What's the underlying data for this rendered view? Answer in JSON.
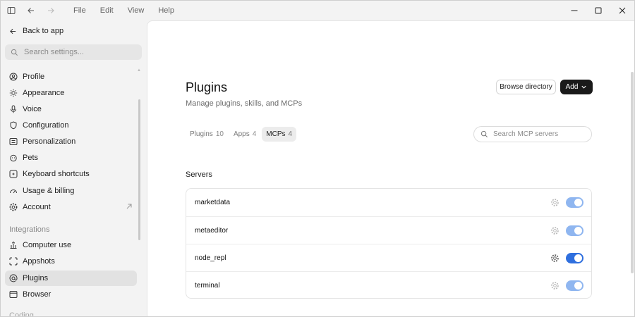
{
  "titlebar": {
    "menu": [
      "File",
      "Edit",
      "View",
      "Help"
    ]
  },
  "sidebar": {
    "back_label": "Back to app",
    "search_placeholder": "Search settings...",
    "items": [
      {
        "label": "Profile",
        "icon": "user-icon"
      },
      {
        "label": "Appearance",
        "icon": "sun-icon"
      },
      {
        "label": "Voice",
        "icon": "microphone-icon"
      },
      {
        "label": "Configuration",
        "icon": "shield-icon"
      },
      {
        "label": "Personalization",
        "icon": "sliders-icon"
      },
      {
        "label": "Pets",
        "icon": "pet-icon"
      },
      {
        "label": "Keyboard shortcuts",
        "icon": "keyboard-icon"
      },
      {
        "label": "Usage & billing",
        "icon": "gauge-icon"
      },
      {
        "label": "Account",
        "icon": "settings-icon"
      }
    ],
    "integrations_label": "Integrations",
    "integrations": [
      {
        "label": "Computer use",
        "icon": "cursor-icon"
      },
      {
        "label": "Appshots",
        "icon": "capture-icon"
      },
      {
        "label": "Plugins",
        "icon": "at-icon",
        "active": true
      },
      {
        "label": "Browser",
        "icon": "browser-icon"
      }
    ],
    "coding_label": "Coding"
  },
  "main": {
    "title": "Plugins",
    "subtitle": "Manage plugins, skills, and MCPs",
    "browse_label": "Browse directory",
    "add_label": "Add",
    "tabs": [
      {
        "label": "Plugins",
        "count": "10"
      },
      {
        "label": "Apps",
        "count": "4"
      },
      {
        "label": "MCPs",
        "count": "4",
        "active": true
      }
    ],
    "search_placeholder": "Search MCP servers",
    "servers_title": "Servers",
    "servers": [
      {
        "name": "marketdata",
        "enabled": true
      },
      {
        "name": "metaeditor",
        "enabled": true
      },
      {
        "name": "node_repl",
        "enabled": true
      },
      {
        "name": "terminal",
        "enabled": true
      }
    ]
  },
  "colors": {
    "toggle_light": "#8fb6f0",
    "toggle_strong": "#2f6fde",
    "add_button": "#1a1a1a"
  }
}
